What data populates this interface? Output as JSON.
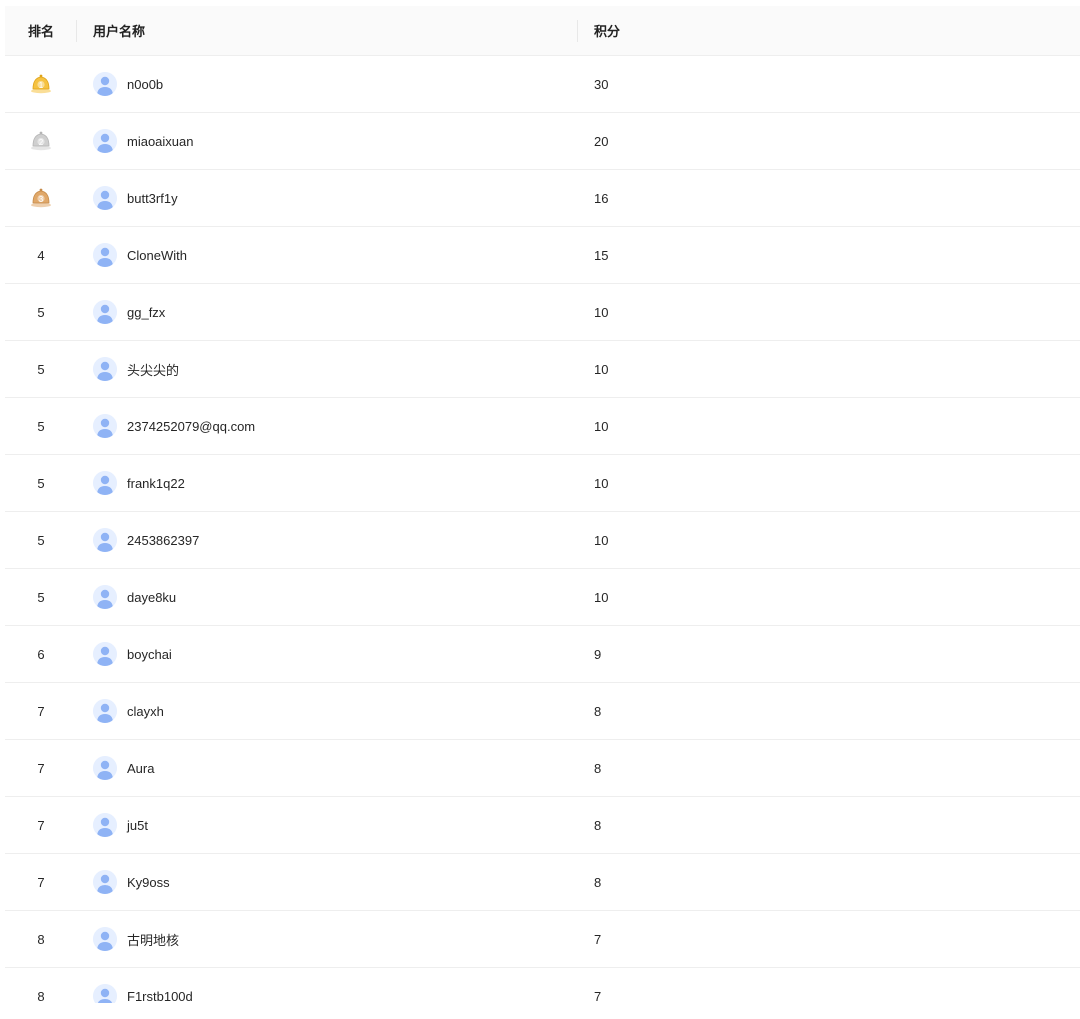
{
  "table": {
    "headers": {
      "rank": "排名",
      "username": "用户名称",
      "score": "积分"
    },
    "rows": [
      {
        "rank": "1",
        "username": "n0o0b",
        "score": "30"
      },
      {
        "rank": "2",
        "username": "miaoaixuan",
        "score": "20"
      },
      {
        "rank": "3",
        "username": "butt3rf1y",
        "score": "16"
      },
      {
        "rank": "4",
        "username": "CloneWith",
        "score": "15"
      },
      {
        "rank": "5",
        "username": "gg_fzx",
        "score": "10"
      },
      {
        "rank": "5",
        "username": "头尖尖的",
        "score": "10"
      },
      {
        "rank": "5",
        "username": "2374252079@qq.com",
        "score": "10"
      },
      {
        "rank": "5",
        "username": "frank1q22",
        "score": "10"
      },
      {
        "rank": "5",
        "username": "2453862397",
        "score": "10"
      },
      {
        "rank": "5",
        "username": "daye8ku",
        "score": "10"
      },
      {
        "rank": "6",
        "username": "boychai",
        "score": "9"
      },
      {
        "rank": "7",
        "username": "clayxh",
        "score": "8"
      },
      {
        "rank": "7",
        "username": "Aura",
        "score": "8"
      },
      {
        "rank": "7",
        "username": "ju5t",
        "score": "8"
      },
      {
        "rank": "7",
        "username": "Ky9oss",
        "score": "8"
      },
      {
        "rank": "8",
        "username": "古明地核",
        "score": "7"
      },
      {
        "rank": "8",
        "username": "F1rstb100d",
        "score": "7"
      }
    ]
  },
  "medals": {
    "gold": "#f5c242",
    "silver": "#cfcfcf",
    "bronze": "#e0a86a"
  },
  "icons": {
    "medal": "medal-icon",
    "avatar": "user-avatar-icon"
  }
}
